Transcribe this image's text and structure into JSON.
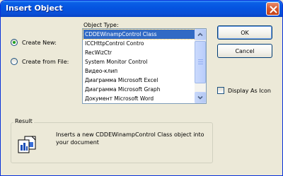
{
  "window": {
    "title": "Insert Object"
  },
  "options": {
    "create_new_label": "Create New:",
    "create_from_file_label": "Create from File:",
    "selected": "create_new"
  },
  "object_type": {
    "label": "Object Type:",
    "items": [
      "CDDEWinampControl Class",
      "ICCHttpControl Contro",
      "RecWizCtr",
      "System Monitor Control",
      "Видео-клип",
      "Диаграмма Microsoft Excel",
      "Диаграмма Microsoft Graph",
      "Документ Microsoft Word"
    ],
    "selected_index": 0
  },
  "buttons": {
    "ok_label": "OK",
    "cancel_label": "Cancel"
  },
  "display_as_icon": {
    "label": "Display As Icon",
    "checked": false
  },
  "result": {
    "label": "Result",
    "text": "Inserts a new CDDEWinampControl Class object into your document"
  },
  "colors": {
    "titlebar": "#0554e0",
    "selection": "#316ac5",
    "close_button": "#d5562b"
  },
  "icons": {
    "close": "close-icon",
    "scroll_up": "scroll-up-icon",
    "scroll_down": "scroll-down-icon",
    "result": "insert-object-icon"
  }
}
